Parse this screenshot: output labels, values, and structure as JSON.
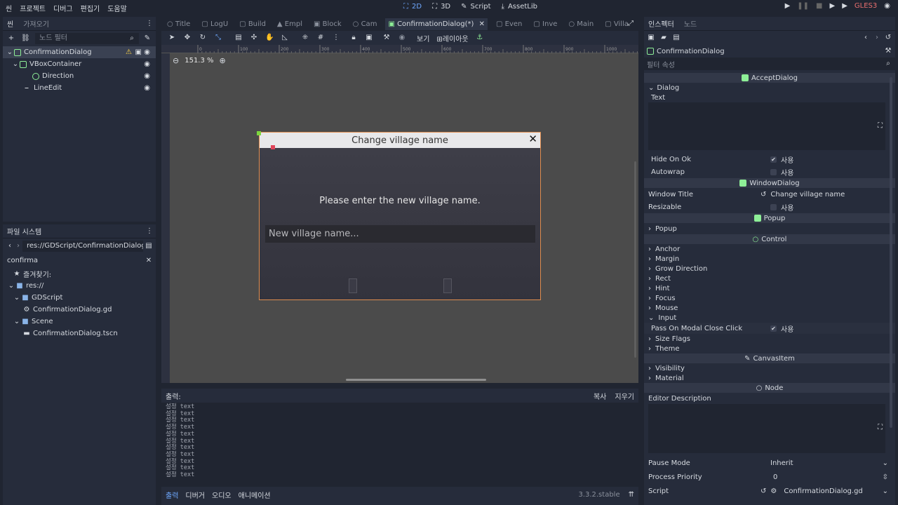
{
  "menubar": {
    "items": [
      "씬",
      "프로젝트",
      "디버그",
      "편집기",
      "도움말"
    ],
    "main_tabs": [
      "2D",
      "3D",
      "Script",
      "AssetLib"
    ],
    "renderer": "GLES3"
  },
  "scene_dock": {
    "tabs": [
      "씬",
      "가져오기"
    ],
    "filter_placeholder": "노드 필터",
    "nodes": [
      {
        "name": "ConfirmationDialog"
      },
      {
        "name": "VBoxContainer"
      },
      {
        "name": "Direction"
      },
      {
        "name": "LineEdit"
      }
    ]
  },
  "fs_dock": {
    "title": "파일 시스템",
    "path": "res://GDScript/ConfirmationDialog.gd",
    "search": "confirma",
    "items": [
      {
        "label": "즐겨찾기:"
      },
      {
        "label": "res://"
      },
      {
        "label": "GDScript"
      },
      {
        "label": "ConfirmationDialog.gd"
      },
      {
        "label": "Scene"
      },
      {
        "label": "ConfirmationDialog.tscn"
      }
    ]
  },
  "editor_tabs": [
    "Title",
    "LogU",
    "Build",
    "Empl",
    "Block",
    "Cam",
    "ConfirmationDialog(*)",
    "Even",
    "Inve",
    "Main",
    "Villa"
  ],
  "toolbar": {
    "view": "보기",
    "layout": "레이아웃"
  },
  "viewport": {
    "zoom": "151.3 %",
    "ruler": [
      "0",
      "100",
      "200",
      "300",
      "400",
      "500",
      "600",
      "700",
      "800",
      "900",
      "1000"
    ]
  },
  "dialog": {
    "title": "Change village name",
    "message": "Please enter the new village name.",
    "input_placeholder": "New village name..."
  },
  "output": {
    "title": "출력:",
    "copy": "복사",
    "clear": "지우기",
    "lines": [
      "설정 text",
      "설정 text",
      "설정 text",
      "설정 text",
      "설정 text",
      "설정 text",
      "설정 text",
      "설정 text",
      "설정 text",
      "설정 text",
      "설정 text"
    ],
    "tabs": [
      "출력",
      "디버거",
      "오디오",
      "애니메이션"
    ],
    "version": "3.3.2.stable"
  },
  "inspector": {
    "tabs": [
      "인스펙터",
      "노드"
    ],
    "node_name": "ConfirmationDialog",
    "filter_placeholder": "필터 속성",
    "accept_section": "AcceptDialog",
    "dialog_group": "Dialog",
    "text_label": "Text",
    "hide_on_ok": "Hide On Ok",
    "autowrap": "Autowrap",
    "on_label": "사용",
    "window_section": "WindowDialog",
    "window_title_label": "Window Title",
    "window_title_value": "Change village name",
    "resizable": "Resizable",
    "popup_section": "Popup",
    "popup_group": "Popup",
    "control_section": "Control",
    "control_groups": [
      "Anchor",
      "Margin",
      "Grow Direction",
      "Rect",
      "Hint",
      "Focus",
      "Mouse",
      "Input"
    ],
    "pass_modal": "Pass On Modal Close Click",
    "control_groups2": [
      "Size Flags",
      "Theme"
    ],
    "canvas_section": "CanvasItem",
    "canvas_groups": [
      "Visibility",
      "Material"
    ],
    "node_section": "Node",
    "editor_desc": "Editor Description",
    "pause_mode": "Pause Mode",
    "pause_value": "Inherit",
    "priority": "Process Priority",
    "priority_value": "0",
    "script": "Script",
    "script_value": "ConfirmationDialog.gd"
  }
}
